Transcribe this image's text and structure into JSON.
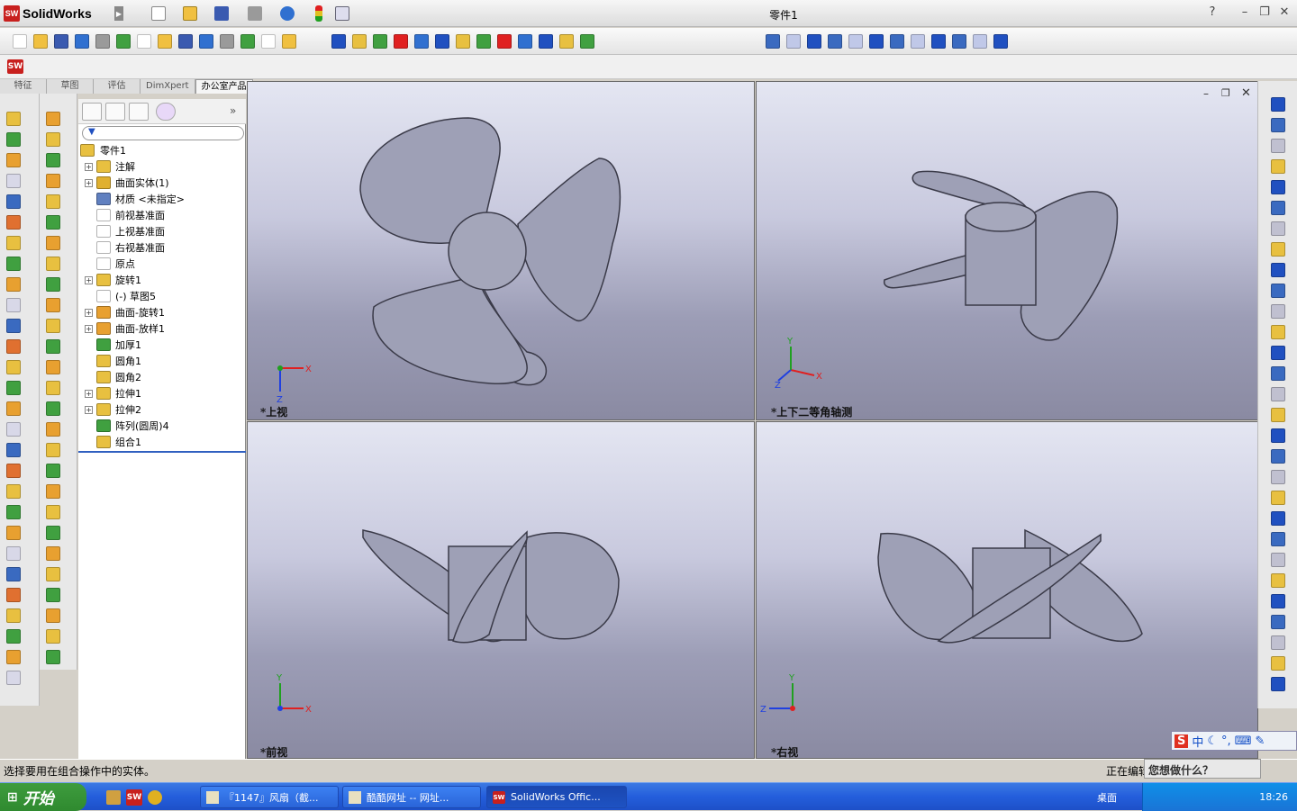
{
  "app": {
    "name": "SolidWorks",
    "badge": "SW",
    "document_title": "零件1"
  },
  "window_controls": {
    "help": "?",
    "minimize": "–",
    "restore": "❐",
    "close": "✕"
  },
  "command_tabs": [
    "特征",
    "草图",
    "评估",
    "DimXpert",
    "办公室产品"
  ],
  "active_command_tab": "办公室产品",
  "tree": {
    "root": "零件1",
    "items": [
      {
        "label": "注解",
        "expandable": true,
        "icon_color": "#e8c040"
      },
      {
        "label": "曲面实体(1)",
        "expandable": true,
        "icon_color": "#e0b030"
      },
      {
        "label": "材质 <未指定>",
        "expandable": false,
        "icon_color": "#6080c0"
      },
      {
        "label": "前视基准面",
        "expandable": false,
        "icon_color": "#ffffff"
      },
      {
        "label": "上视基准面",
        "expandable": false,
        "icon_color": "#ffffff"
      },
      {
        "label": "右视基准面",
        "expandable": false,
        "icon_color": "#ffffff"
      },
      {
        "label": "原点",
        "expandable": false,
        "icon_color": "#ffffff"
      },
      {
        "label": "旋转1",
        "expandable": true,
        "icon_color": "#e8c040"
      },
      {
        "label": "(-) 草图5",
        "expandable": false,
        "icon_color": "#ffffff"
      },
      {
        "label": "曲面-旋转1",
        "expandable": true,
        "icon_color": "#e8a030"
      },
      {
        "label": "曲面-放样1",
        "expandable": true,
        "icon_color": "#e8a030"
      },
      {
        "label": "加厚1",
        "expandable": false,
        "icon_color": "#40a040"
      },
      {
        "label": "圆角1",
        "expandable": false,
        "icon_color": "#e8c040"
      },
      {
        "label": "圆角2",
        "expandable": false,
        "icon_color": "#e8c040"
      },
      {
        "label": "拉伸1",
        "expandable": true,
        "icon_color": "#e8c040"
      },
      {
        "label": "拉伸2",
        "expandable": true,
        "icon_color": "#e8c040"
      },
      {
        "label": "阵列(圆周)4",
        "expandable": false,
        "icon_color": "#40a040"
      },
      {
        "label": "组合1",
        "expandable": false,
        "icon_color": "#e8c040"
      }
    ]
  },
  "viewports": [
    {
      "label": "*上视"
    },
    {
      "label": "*上下二等角轴测"
    },
    {
      "label": "*前视"
    },
    {
      "label": "*右视"
    }
  ],
  "axes": {
    "x": "X",
    "y": "Y",
    "z": "Z"
  },
  "status": {
    "message": "选择要用在组合操作中的实体。",
    "editing": "正在编辑",
    "help_prompt": "您想做什么？"
  },
  "ime": {
    "logo": "S",
    "lang": "中",
    "punct": "°,"
  },
  "taskbar": {
    "start": "开始",
    "buttons": [
      "『1147』风扇（截...",
      "酷酷网址 -- 网址...",
      "SolidWorks Offic..."
    ],
    "active_button": "SolidWorks Offic...",
    "desktop": "桌面",
    "clock": "18:26"
  },
  "colors": {
    "brand": "#c8201e",
    "taskbar": "#245edc",
    "start": "#3a943a",
    "part": "#9ea0b6"
  }
}
